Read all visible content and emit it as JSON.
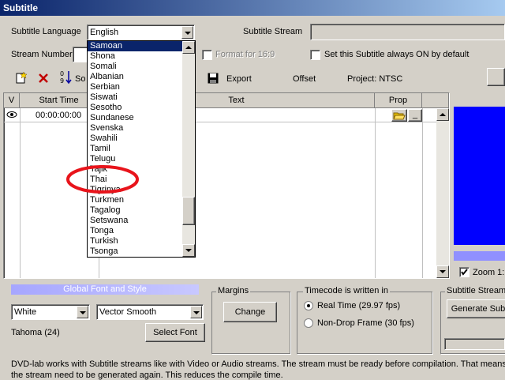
{
  "window": {
    "title": "Subtitle"
  },
  "top": {
    "language_label": "Subtitle Language",
    "language_value": "English",
    "stream_label": "Subtitle Stream",
    "stream_number_label": "Stream Number:",
    "format_label": "Format for 16:9",
    "always_on_label": "Set this Subtitle always ON by default"
  },
  "toolbar": {
    "so_label": "So",
    "export_label": "Export",
    "offset_label": "Offset",
    "project_label": "Project: NTSC"
  },
  "grid": {
    "columns": [
      "V",
      "Start Time",
      "Text",
      "Prop"
    ],
    "row": {
      "start": "00:00:00:00",
      "minus": "_"
    }
  },
  "dropdown": {
    "items": [
      "Samoan",
      "Shona",
      "Somali",
      "Albanian",
      "Serbian",
      "Siswati",
      "Sesotho",
      "Sundanese",
      "Svenska",
      "Swahili",
      "Tamil",
      "Telugu",
      "Tajik",
      "Thai",
      "Tigrinya",
      "Turkmen",
      "Tagalog",
      "Setswana",
      "Tonga",
      "Turkish",
      "Tsonga"
    ],
    "selected": "Samoan",
    "highlighted": "Thai"
  },
  "font": {
    "header": "Global Font and Style",
    "color_value": "White",
    "style_value": "Vector Smooth",
    "font_name": "Tahoma (24)",
    "select_font_label": "Select Font"
  },
  "margins": {
    "label": "Margins",
    "change_label": "Change"
  },
  "timecode": {
    "label": "Timecode is written in",
    "real_time": "Real Time (29.97 fps)",
    "drop_frame": "Non-Drop Frame (30 fps)"
  },
  "stream_box": {
    "label": "Subtitle Stream",
    "generate_label": "Generate Sub"
  },
  "zoom": {
    "label": "Zoom 1:"
  },
  "info": {
    "line1": "DVD-lab works with Subtitle streams like with Video or Audio streams. The stream must be ready before compilation. That means each",
    "line2": "the stream need to be generated again. This reduces the compile time."
  },
  "colors": {
    "highlight_circle": "#e8141b",
    "preview_blue": "#0000ff",
    "title_bar": "#0a246a"
  }
}
